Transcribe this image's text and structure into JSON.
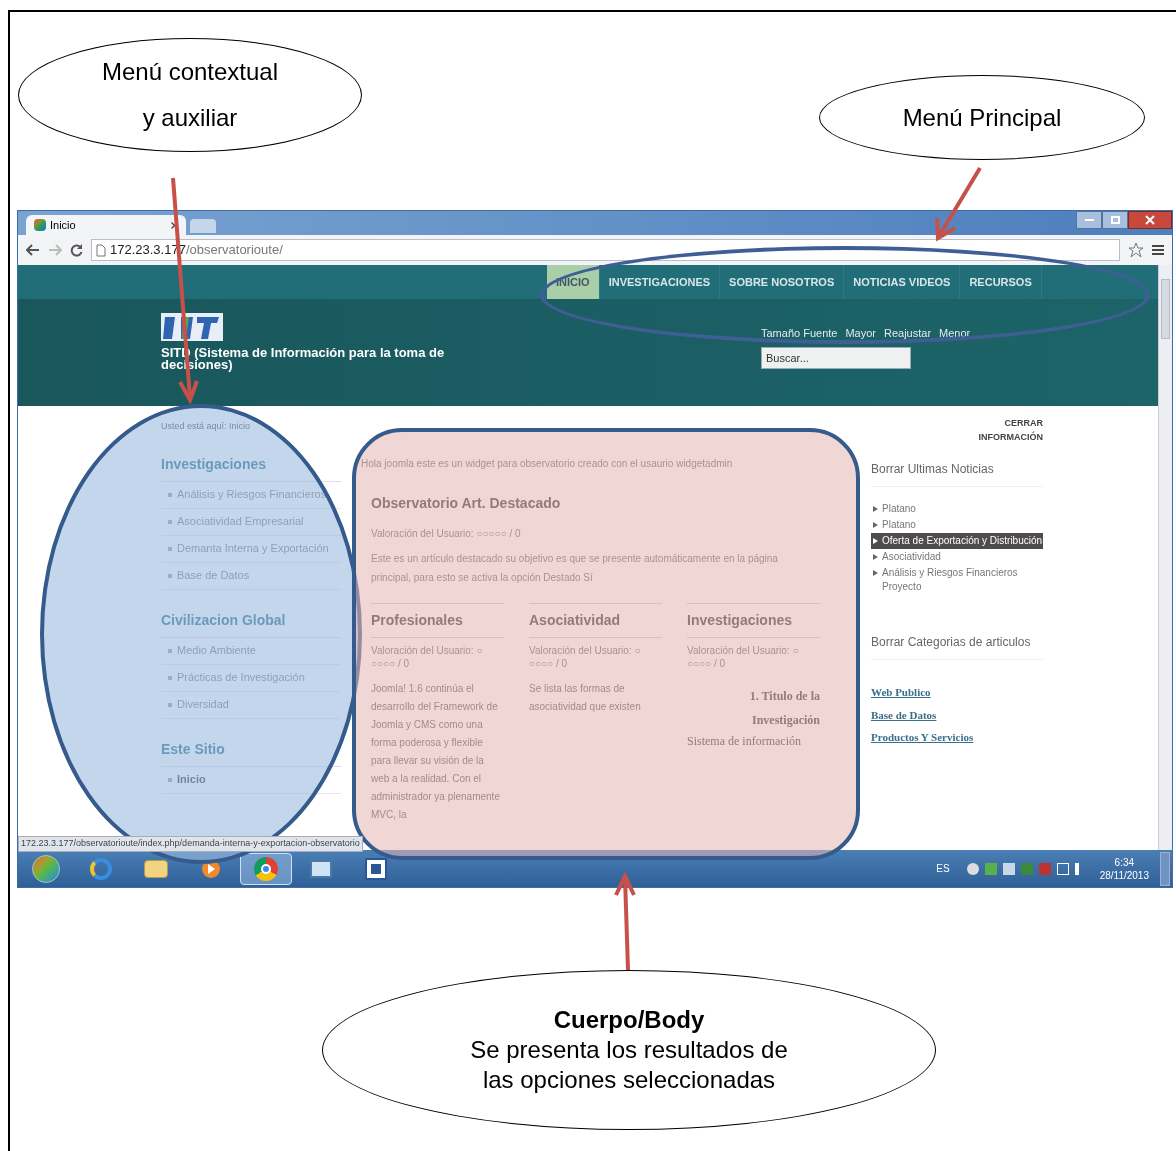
{
  "callouts": [
    {
      "lines": [
        "Menú contextual",
        "y auxiliar"
      ]
    },
    {
      "lines": [
        "Menú Principal"
      ]
    },
    {
      "title": "Cuerpo/Body",
      "lines": [
        "Se presenta los resultados de",
        "las opciones seleccionadas"
      ]
    }
  ],
  "browser": {
    "tab": "Inicio",
    "url_host": "172.23.3.177",
    "url_path": "/observatorioute/"
  },
  "site": {
    "nav": [
      {
        "label": "INICIO",
        "selected": true
      },
      {
        "label": "INVESTIGACIONES",
        "selected": false
      },
      {
        "label": "SOBRE NOSOTROS",
        "selected": false
      },
      {
        "label": "NOTICIAS VIDEOS",
        "selected": false
      },
      {
        "label": "RECURSOS",
        "selected": false
      }
    ],
    "title": "SITD (Sistema de Información para la toma de decisiones)",
    "font_size": {
      "label": "Tamaño Fuente",
      "options": [
        "Mayor",
        "Reajustar",
        "Menor"
      ]
    },
    "search": {
      "placeholder": "Buscar..."
    }
  },
  "breadcrumb": "Usted está aquí: Inicio",
  "sidebar": [
    {
      "title": "Investigaciones",
      "items": [
        {
          "label": "Análisis y Riesgos Financieros",
          "selected": false
        },
        {
          "label": "Asociatividad Empresarial",
          "selected": false
        },
        {
          "label": "Demanta Interna y Exportación",
          "selected": false
        },
        {
          "label": "Base de Datos",
          "selected": false
        }
      ]
    },
    {
      "title": "Civilizacion Global",
      "items": [
        {
          "label": "Medio Ambiente",
          "selected": false
        },
        {
          "label": "Prácticas de Investigación",
          "selected": false
        },
        {
          "label": "Diversidad",
          "selected": false
        }
      ]
    },
    {
      "title": "Este Sitio",
      "items": [
        {
          "label": "Inicio",
          "selected": true
        }
      ]
    }
  ],
  "main": {
    "intro": "Hola joomla este es un widget para observatorio creado con el usaurio widgetadmin",
    "featured": {
      "title": "Observatorio Art. Destacado",
      "rating": "Valoración del Usuario: ○○○○○ / 0",
      "body": "Este es un artículo destacado su objetivo es que se presente automáticamente en la página principal, para esto se activa la opción Destado Sí"
    },
    "columns": [
      {
        "title": "Profesionales",
        "rating": "Valoración del Usuario: ○ ○○○○ / 0",
        "kind": "text",
        "body": "Joomla! 1.6 continúa el desarrollo del Framework de Joomla y CMS como una forma poderosa y flexible para llevar su visión de la web a la realidad. Con el administrador ya plenamente MVC, la"
      },
      {
        "title": "Asociatividad",
        "rating": "Valoración del Usuario: ○ ○○○○ / 0",
        "kind": "text",
        "body": "Se lista las formas de asociatividad que existen"
      },
      {
        "title": "Investigaciones",
        "rating": "Valoración del Usuario: ○ ○○○○ / 0",
        "kind": "document",
        "heading": "1. Titulo de la Investigación",
        "body": "Sistema de información"
      }
    ]
  },
  "aside": {
    "close": "CERRAR INFORMACIÓN",
    "news": {
      "title": "Borrar Ultimas Noticias",
      "items": [
        {
          "label": "Platano",
          "selected": false
        },
        {
          "label": "Platano",
          "selected": false
        },
        {
          "label": "Oferta de Exportación y Distribución",
          "selected": true
        },
        {
          "label": "Asociatividad",
          "selected": false
        },
        {
          "label": "Análisis y Riesgos Financieros Proyecto",
          "selected": false
        }
      ]
    },
    "categories": {
      "title": "Borrar Categorias de articulos",
      "links": [
        "Web Publico",
        "Base de Datos",
        "Productos Y Servicios"
      ]
    }
  },
  "status_url": "172.23.3.177/observatorioute/index.php/demanda-interna-y-exportacion-observatorio",
  "tray": {
    "language": "ES",
    "time": "6:34",
    "date": "28/11/2013"
  }
}
